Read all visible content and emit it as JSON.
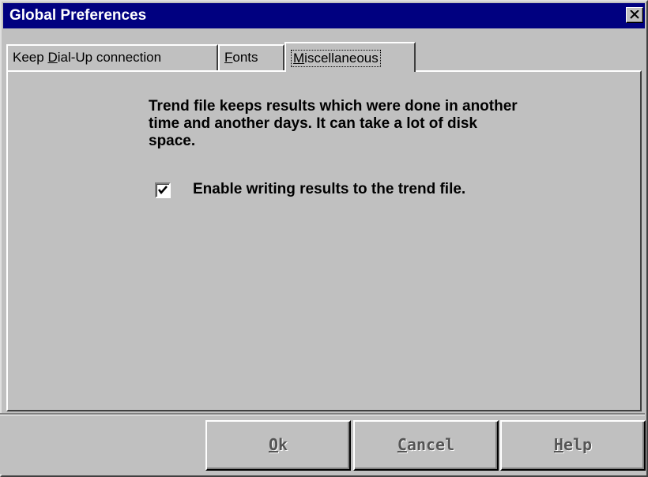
{
  "window": {
    "title": "Global Preferences"
  },
  "tabs": [
    {
      "label_pre": "Keep ",
      "label_u": "D",
      "label_post": "ial-Up connection"
    },
    {
      "label_pre": "",
      "label_u": "F",
      "label_post": "onts"
    },
    {
      "label_pre": "",
      "label_u": "M",
      "label_post": "iscellaneous"
    }
  ],
  "active_tab": "Miscellaneous",
  "panel": {
    "description_lines": [
      "Trend file keeps results which were done in another",
      "time and another days. It can take a lot of disk",
      "space."
    ],
    "checkbox": {
      "label": "Enable writing results to the trend file.",
      "checked": true
    }
  },
  "buttons": {
    "ok": {
      "u": "O",
      "rest": "k"
    },
    "cancel": {
      "u": "C",
      "rest": "ancel"
    },
    "help": {
      "u": "H",
      "rest": "elp"
    }
  },
  "colors": {
    "titlebar": "#000080",
    "face": "#c0c0c0"
  },
  "icons": {
    "close": "close-icon",
    "check": "checkmark-icon"
  }
}
